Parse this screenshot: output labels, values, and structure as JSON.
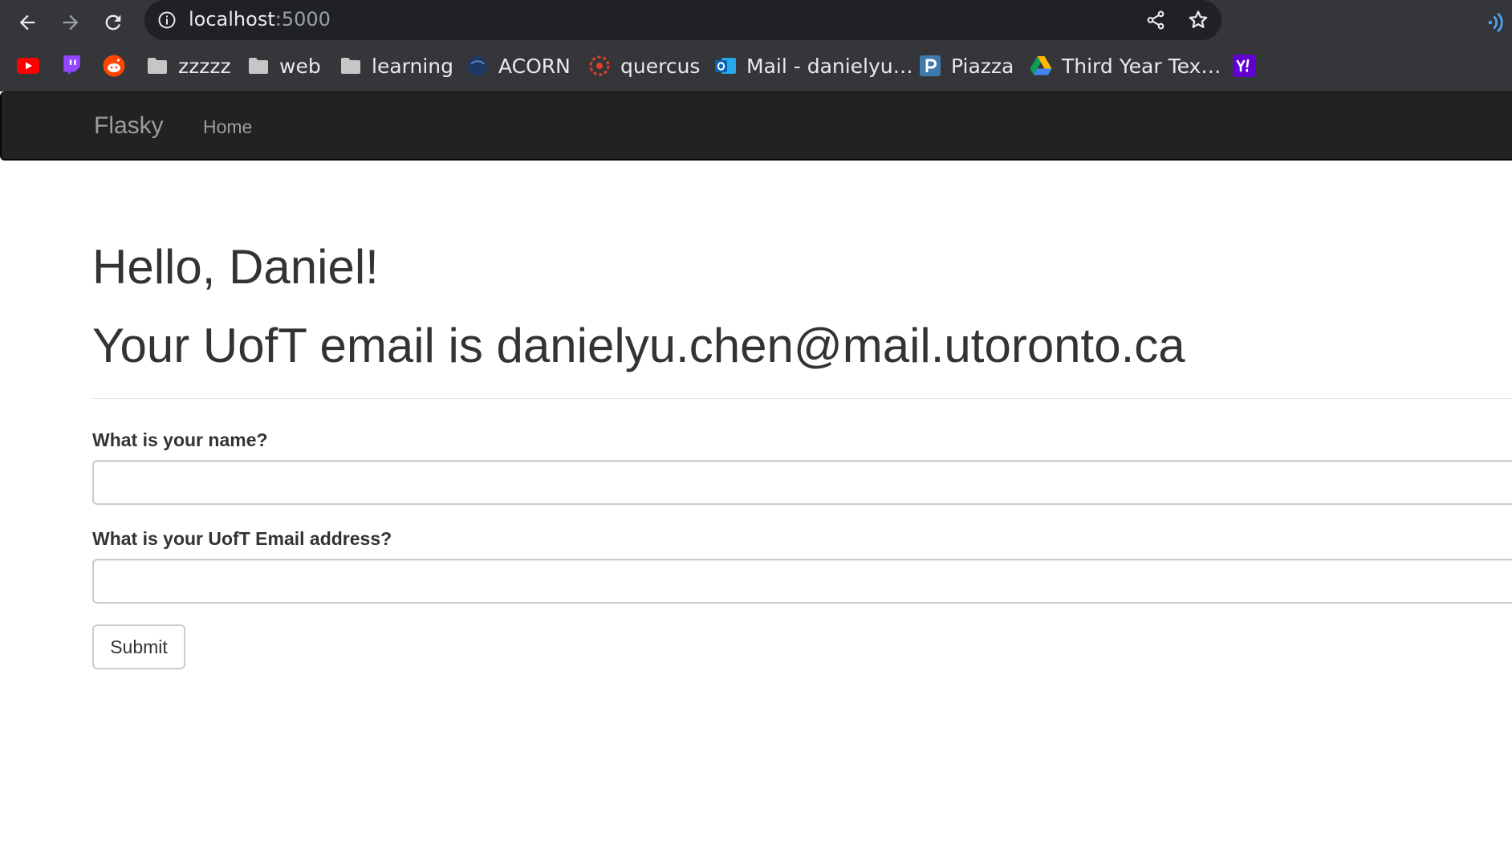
{
  "browser": {
    "url_host": "localhost",
    "url_port": ":5000",
    "bookmarks": [
      {
        "label": "",
        "icon": "youtube-icon"
      },
      {
        "label": "",
        "icon": "twitch-icon"
      },
      {
        "label": "",
        "icon": "reddit-icon"
      },
      {
        "label": "zzzzz",
        "icon": "folder-icon"
      },
      {
        "label": "web",
        "icon": "folder-icon"
      },
      {
        "label": "learning",
        "icon": "folder-icon"
      },
      {
        "label": "ACORN",
        "icon": "acorn-icon"
      },
      {
        "label": "quercus",
        "icon": "quercus-icon"
      },
      {
        "label": "Mail - danielyu…",
        "icon": "outlook-icon"
      },
      {
        "label": "Piazza",
        "icon": "piazza-icon"
      },
      {
        "label": "Third Year Tex…",
        "icon": "google-drive-icon"
      },
      {
        "label": "",
        "icon": "yahoo-icon"
      }
    ],
    "colors": {
      "chrome_bg": "#35363a",
      "omnibox_bg": "#202124",
      "text": "#e8eaed"
    }
  },
  "navbar": {
    "brand": "Flasky",
    "links": [
      "Home"
    ],
    "colors": {
      "bg": "#222222",
      "text": "#9d9d9d"
    }
  },
  "page": {
    "greeting": "Hello, Daniel!",
    "email_line": "Your UofT email is danielyu.chen@mail.utoronto.ca"
  },
  "form": {
    "name_label": "What is your name?",
    "name_value": "",
    "email_label": "What is your UofT Email address?",
    "email_value": "",
    "submit_label": "Submit"
  }
}
